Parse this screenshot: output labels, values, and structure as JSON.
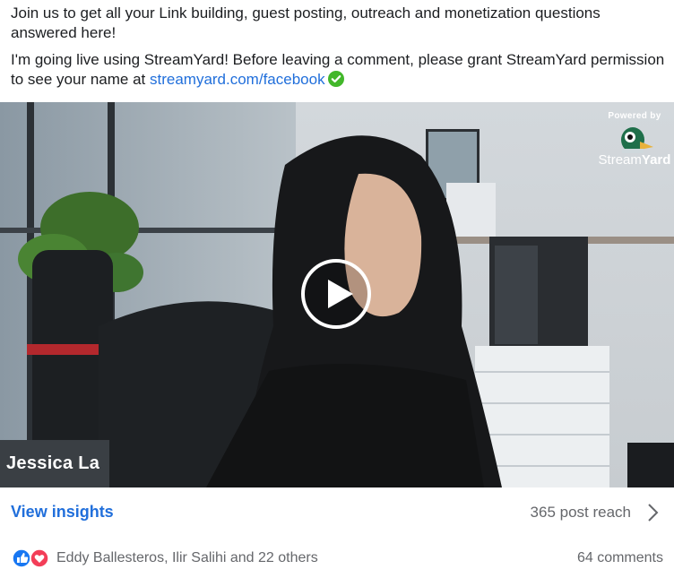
{
  "post": {
    "paragraph1": "Join us to get all your Link building, guest posting, outreach and monetization questions answered here!",
    "paragraph2_text": "I'm going live using StreamYard! Before leaving a comment, please grant StreamYard permission to see your name at ",
    "paragraph2_link": "streamyard.com/facebook"
  },
  "video": {
    "presenter_name": "Jessica La",
    "badge_powered_by": "Powered by",
    "badge_brand_light": "Stream",
    "badge_brand_bold": "Yard",
    "play_icon": "play-icon"
  },
  "insights": {
    "view_label": "View insights",
    "reach_label": "365 post reach"
  },
  "reactions": {
    "icons": [
      "like-icon",
      "love-icon"
    ],
    "reactors_text": "Eddy Ballesteros, Ilir Salihi and 22 others",
    "comments_text": "64 comments"
  },
  "colors": {
    "link_blue": "#216fdb",
    "secondary_text": "#65676b",
    "verified_green": "#42b72a",
    "like_blue": "#1877f2",
    "love_red": "#f33e58"
  }
}
